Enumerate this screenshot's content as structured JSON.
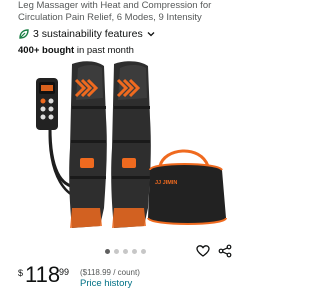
{
  "product": {
    "title": "Leg Massager with Heat and Compression for Circulation Pain Relief, 6 Modes, 9 Intensity",
    "sustainability_label": "3 sustainability features",
    "bought_count": "400+ bought",
    "bought_suffix": " in past month",
    "bag_brand": "JJ JIMIN"
  },
  "gallery": {
    "image_count": 5,
    "active_index": 0
  },
  "price": {
    "currency": "$",
    "whole": "118",
    "fraction": "99",
    "per_unit": "($118.99 / count)",
    "history_link": "Price history"
  },
  "colors": {
    "accent_orange": "#ef6a1f",
    "link": "#007185",
    "sustain_green": "#1a7f45"
  },
  "icons": {
    "sustainability": "leaf-icon",
    "expand": "chevron-down-icon",
    "save": "heart-icon",
    "share": "share-icon"
  }
}
